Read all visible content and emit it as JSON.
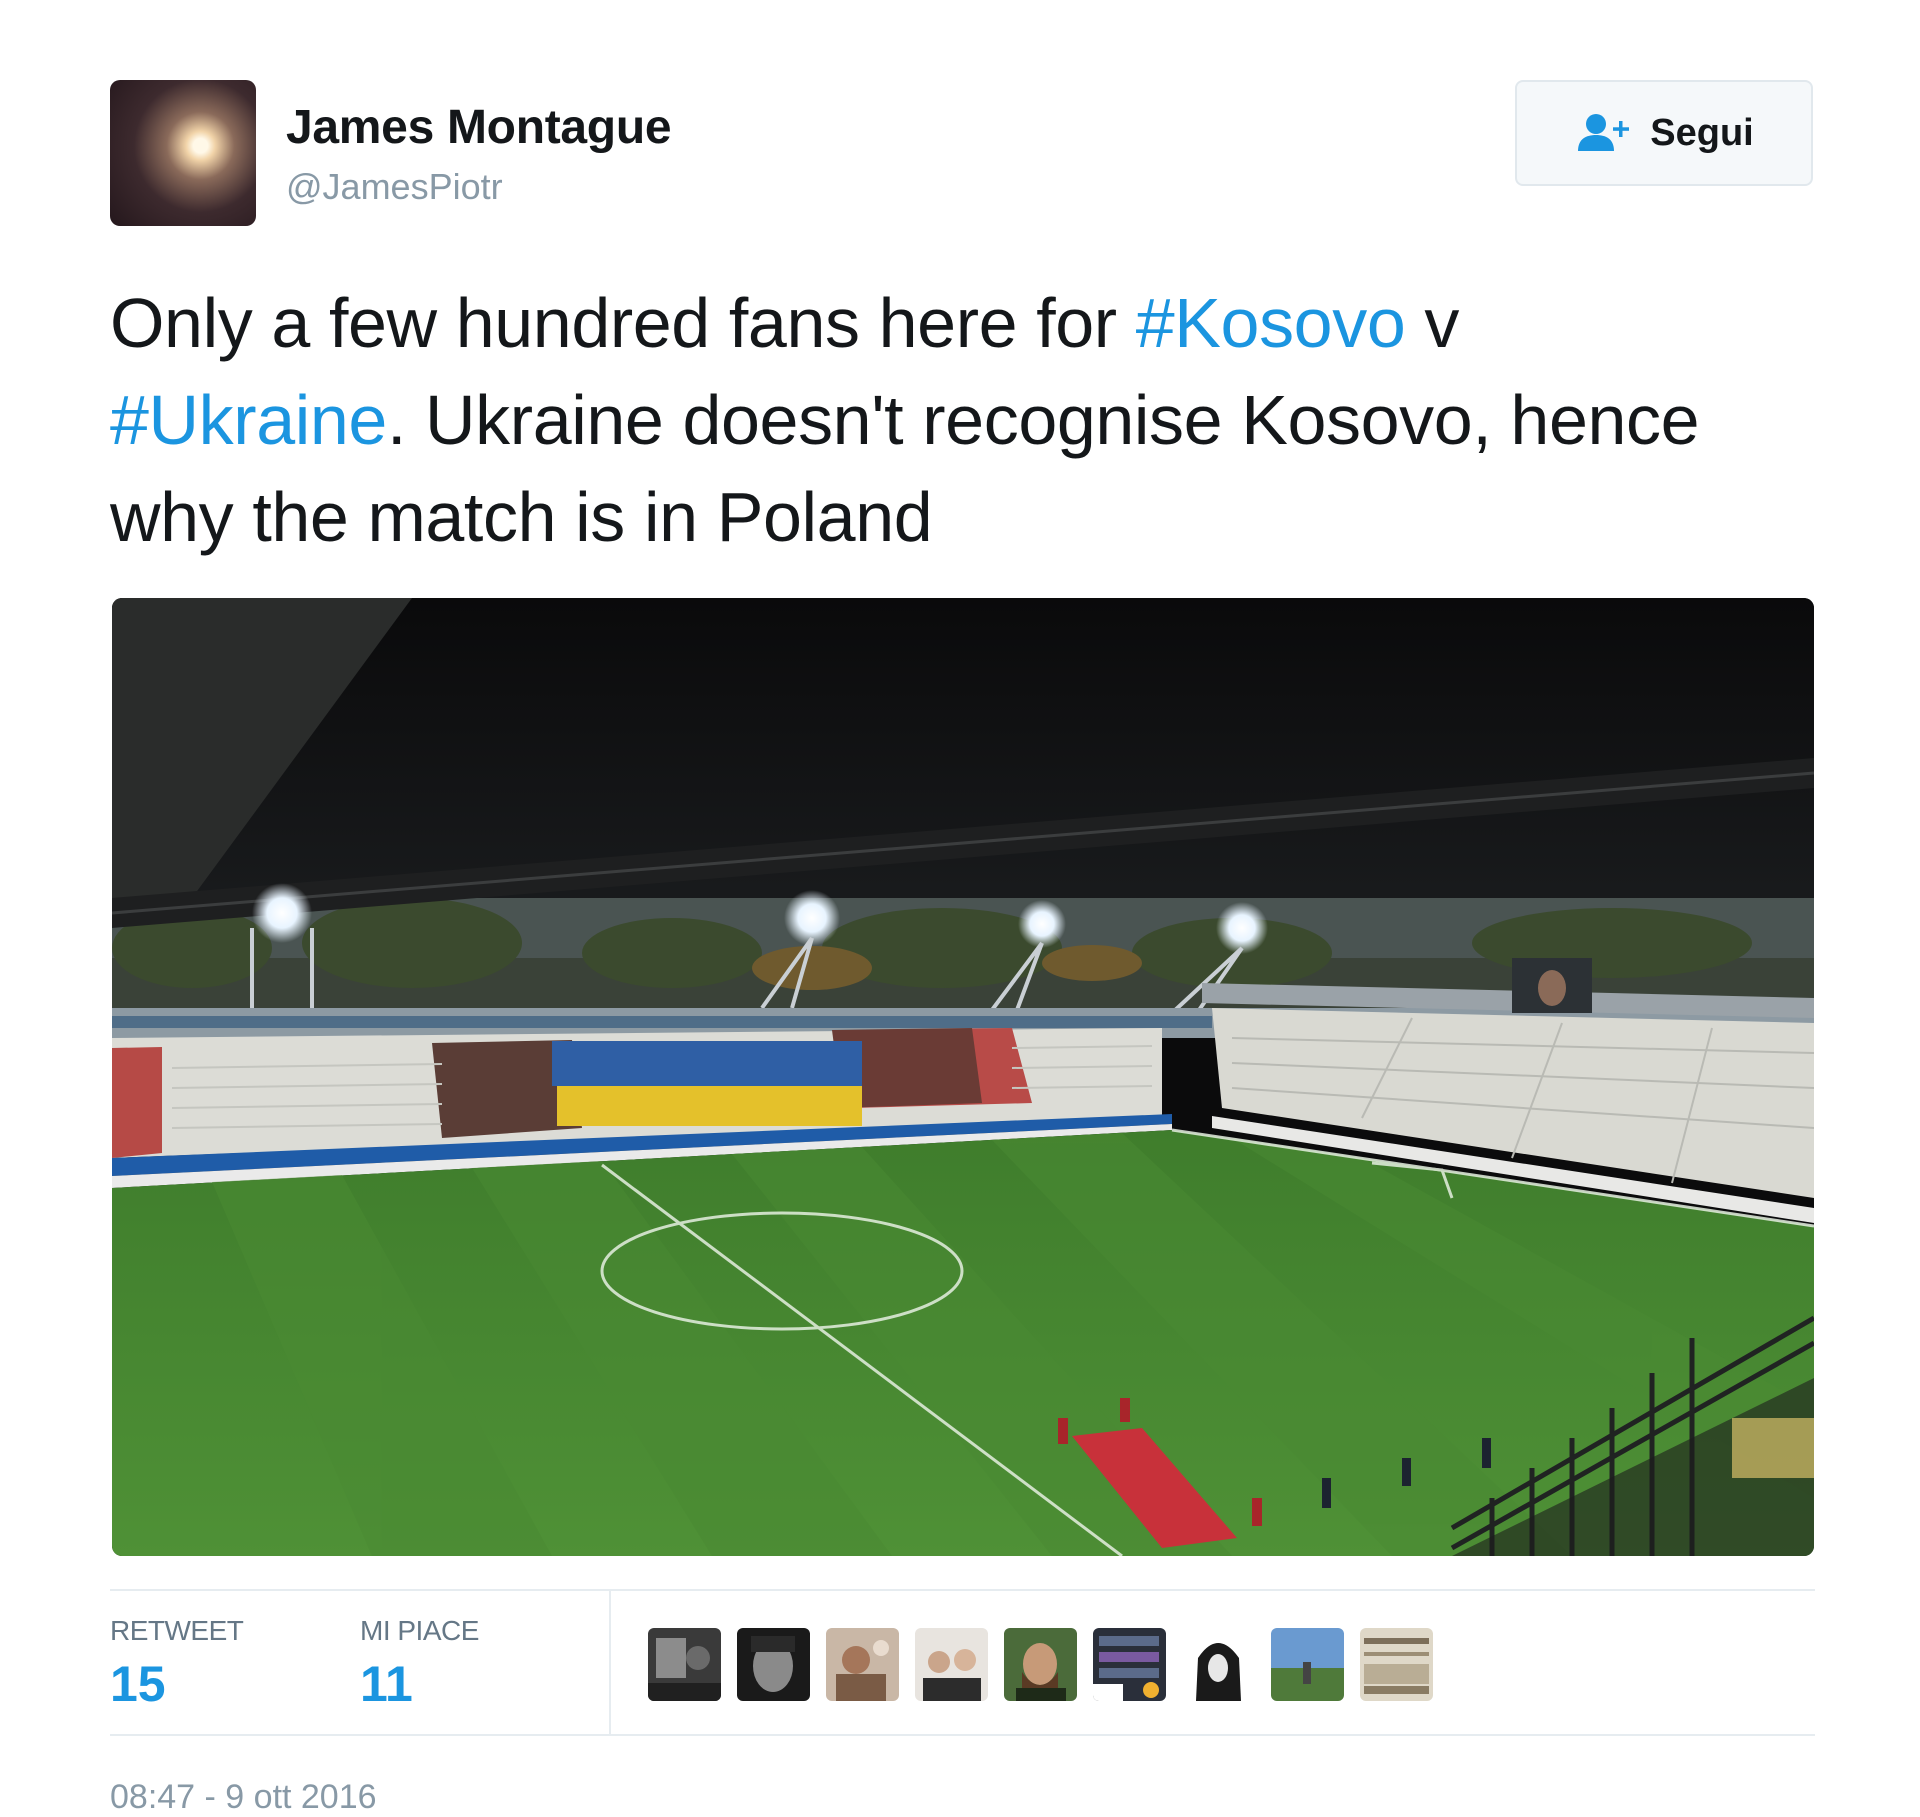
{
  "user": {
    "name": "James Montague",
    "handle": "@JamesPiotr"
  },
  "follow_button": {
    "label": "Segui",
    "icon": "add-user-icon"
  },
  "tweet": {
    "segments": [
      {
        "text": "Only a few hundred fans here for ",
        "type": "text"
      },
      {
        "text": "#Kosovo",
        "type": "hashtag"
      },
      {
        "text": " v ",
        "type": "text"
      },
      {
        "text": "#Ukraine",
        "type": "hashtag"
      },
      {
        "text": ". Ukraine doesn't recognise Kosovo, hence why the match is in Poland",
        "type": "text"
      }
    ],
    "hashtag_color": "#1b95e0",
    "media": {
      "kind": "photo",
      "subject": "stadium-photo"
    }
  },
  "stats": {
    "retweets": {
      "label": "RETWEET",
      "value": "15"
    },
    "likes": {
      "label": "MI PIACE",
      "value": "11"
    }
  },
  "likers_count_shown": 9,
  "timestamp": "08:47 - 9 ott 2016"
}
